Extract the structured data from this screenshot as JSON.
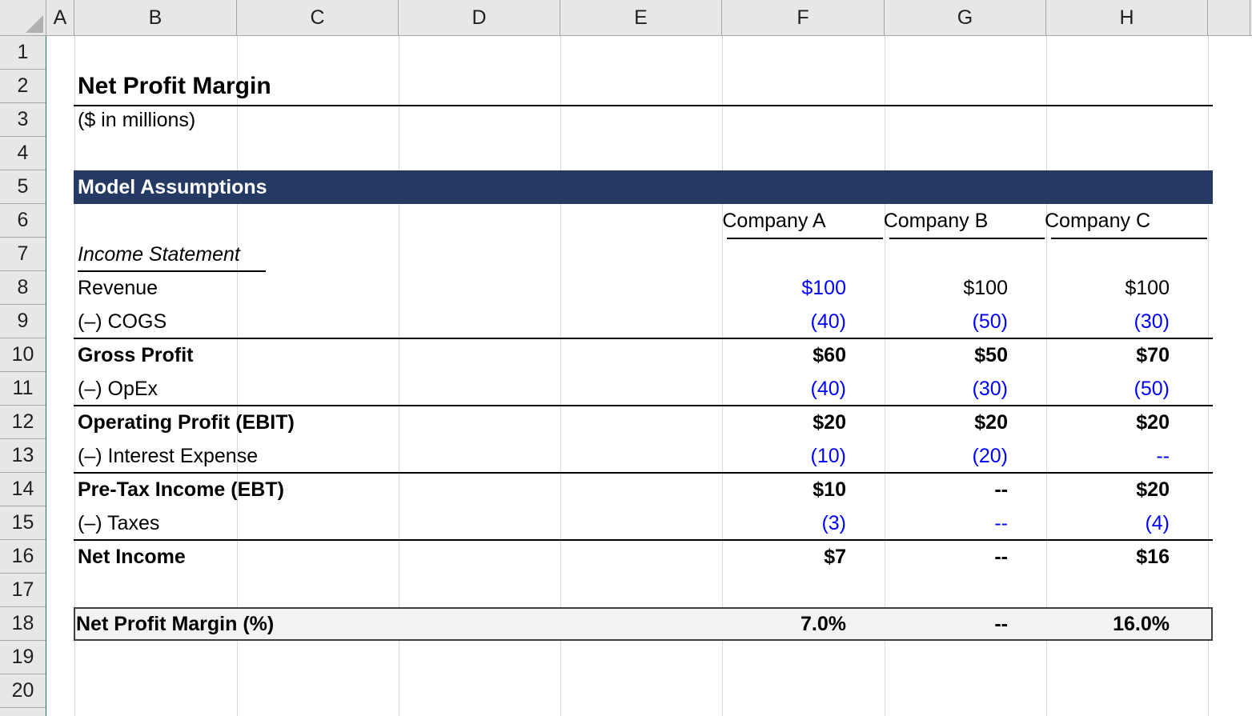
{
  "app": {
    "type": "spreadsheet",
    "corner_select_all": "select-all-corner"
  },
  "columns": [
    "A",
    "B",
    "C",
    "D",
    "E",
    "F",
    "G",
    "H"
  ],
  "rows": [
    "1",
    "2",
    "3",
    "4",
    "5",
    "6",
    "7",
    "8",
    "9",
    "10",
    "11",
    "12",
    "13",
    "14",
    "15",
    "16",
    "17",
    "18",
    "19",
    "20"
  ],
  "colors": {
    "banner_fill": "#243A62",
    "banner_text": "#FFFFFF",
    "input_blue": "#0000FF",
    "formula_black": "#000000",
    "margin_row_fill": "#F2F2F2",
    "header_gray": "#E7E7E7",
    "gridline": "#D9D9D9"
  },
  "sheet": {
    "title": "Net Profit Margin",
    "subtitle": "($ in millions)",
    "banner": "Model Assumptions",
    "section_label": "Income Statement",
    "column_headers": [
      "Company A",
      "Company B",
      "Company C"
    ],
    "line_items": [
      {
        "label": "Revenue",
        "bold": false,
        "values": [
          "$100",
          "$100",
          "$100"
        ],
        "value_colors": [
          "#0000FF",
          "#000000",
          "#000000"
        ]
      },
      {
        "label": "(–) COGS",
        "bold": false,
        "values": [
          "(40)",
          "(50)",
          "(30)"
        ],
        "value_colors": [
          "#0000FF",
          "#0000FF",
          "#0000FF"
        ]
      },
      {
        "label": "Gross Profit",
        "bold": true,
        "values": [
          "$60",
          "$50",
          "$70"
        ],
        "value_colors": [
          "#000000",
          "#000000",
          "#000000"
        ]
      },
      {
        "label": "(–) OpEx",
        "bold": false,
        "values": [
          "(40)",
          "(30)",
          "(50)"
        ],
        "value_colors": [
          "#0000FF",
          "#0000FF",
          "#0000FF"
        ]
      },
      {
        "label": "Operating Profit (EBIT)",
        "bold": true,
        "values": [
          "$20",
          "$20",
          "$20"
        ],
        "value_colors": [
          "#000000",
          "#000000",
          "#000000"
        ]
      },
      {
        "label": "(–) Interest Expense",
        "bold": false,
        "values": [
          "(10)",
          "(20)",
          "--"
        ],
        "value_colors": [
          "#0000FF",
          "#0000FF",
          "#0000FF"
        ]
      },
      {
        "label": "Pre-Tax Income (EBT)",
        "bold": true,
        "values": [
          "$10",
          "--",
          "$20"
        ],
        "value_colors": [
          "#000000",
          "#000000",
          "#000000"
        ]
      },
      {
        "label": "(–) Taxes",
        "bold": false,
        "values": [
          "(3)",
          "--",
          "(4)"
        ],
        "value_colors": [
          "#0000FF",
          "#0000FF",
          "#0000FF"
        ]
      },
      {
        "label": "Net Income",
        "bold": true,
        "values": [
          "$7",
          "--",
          "$16"
        ],
        "value_colors": [
          "#000000",
          "#000000",
          "#000000"
        ]
      }
    ],
    "margin_row": {
      "label": "Net Profit Margin (%)",
      "values": [
        "7.0%",
        "--",
        "16.0%"
      ]
    }
  }
}
